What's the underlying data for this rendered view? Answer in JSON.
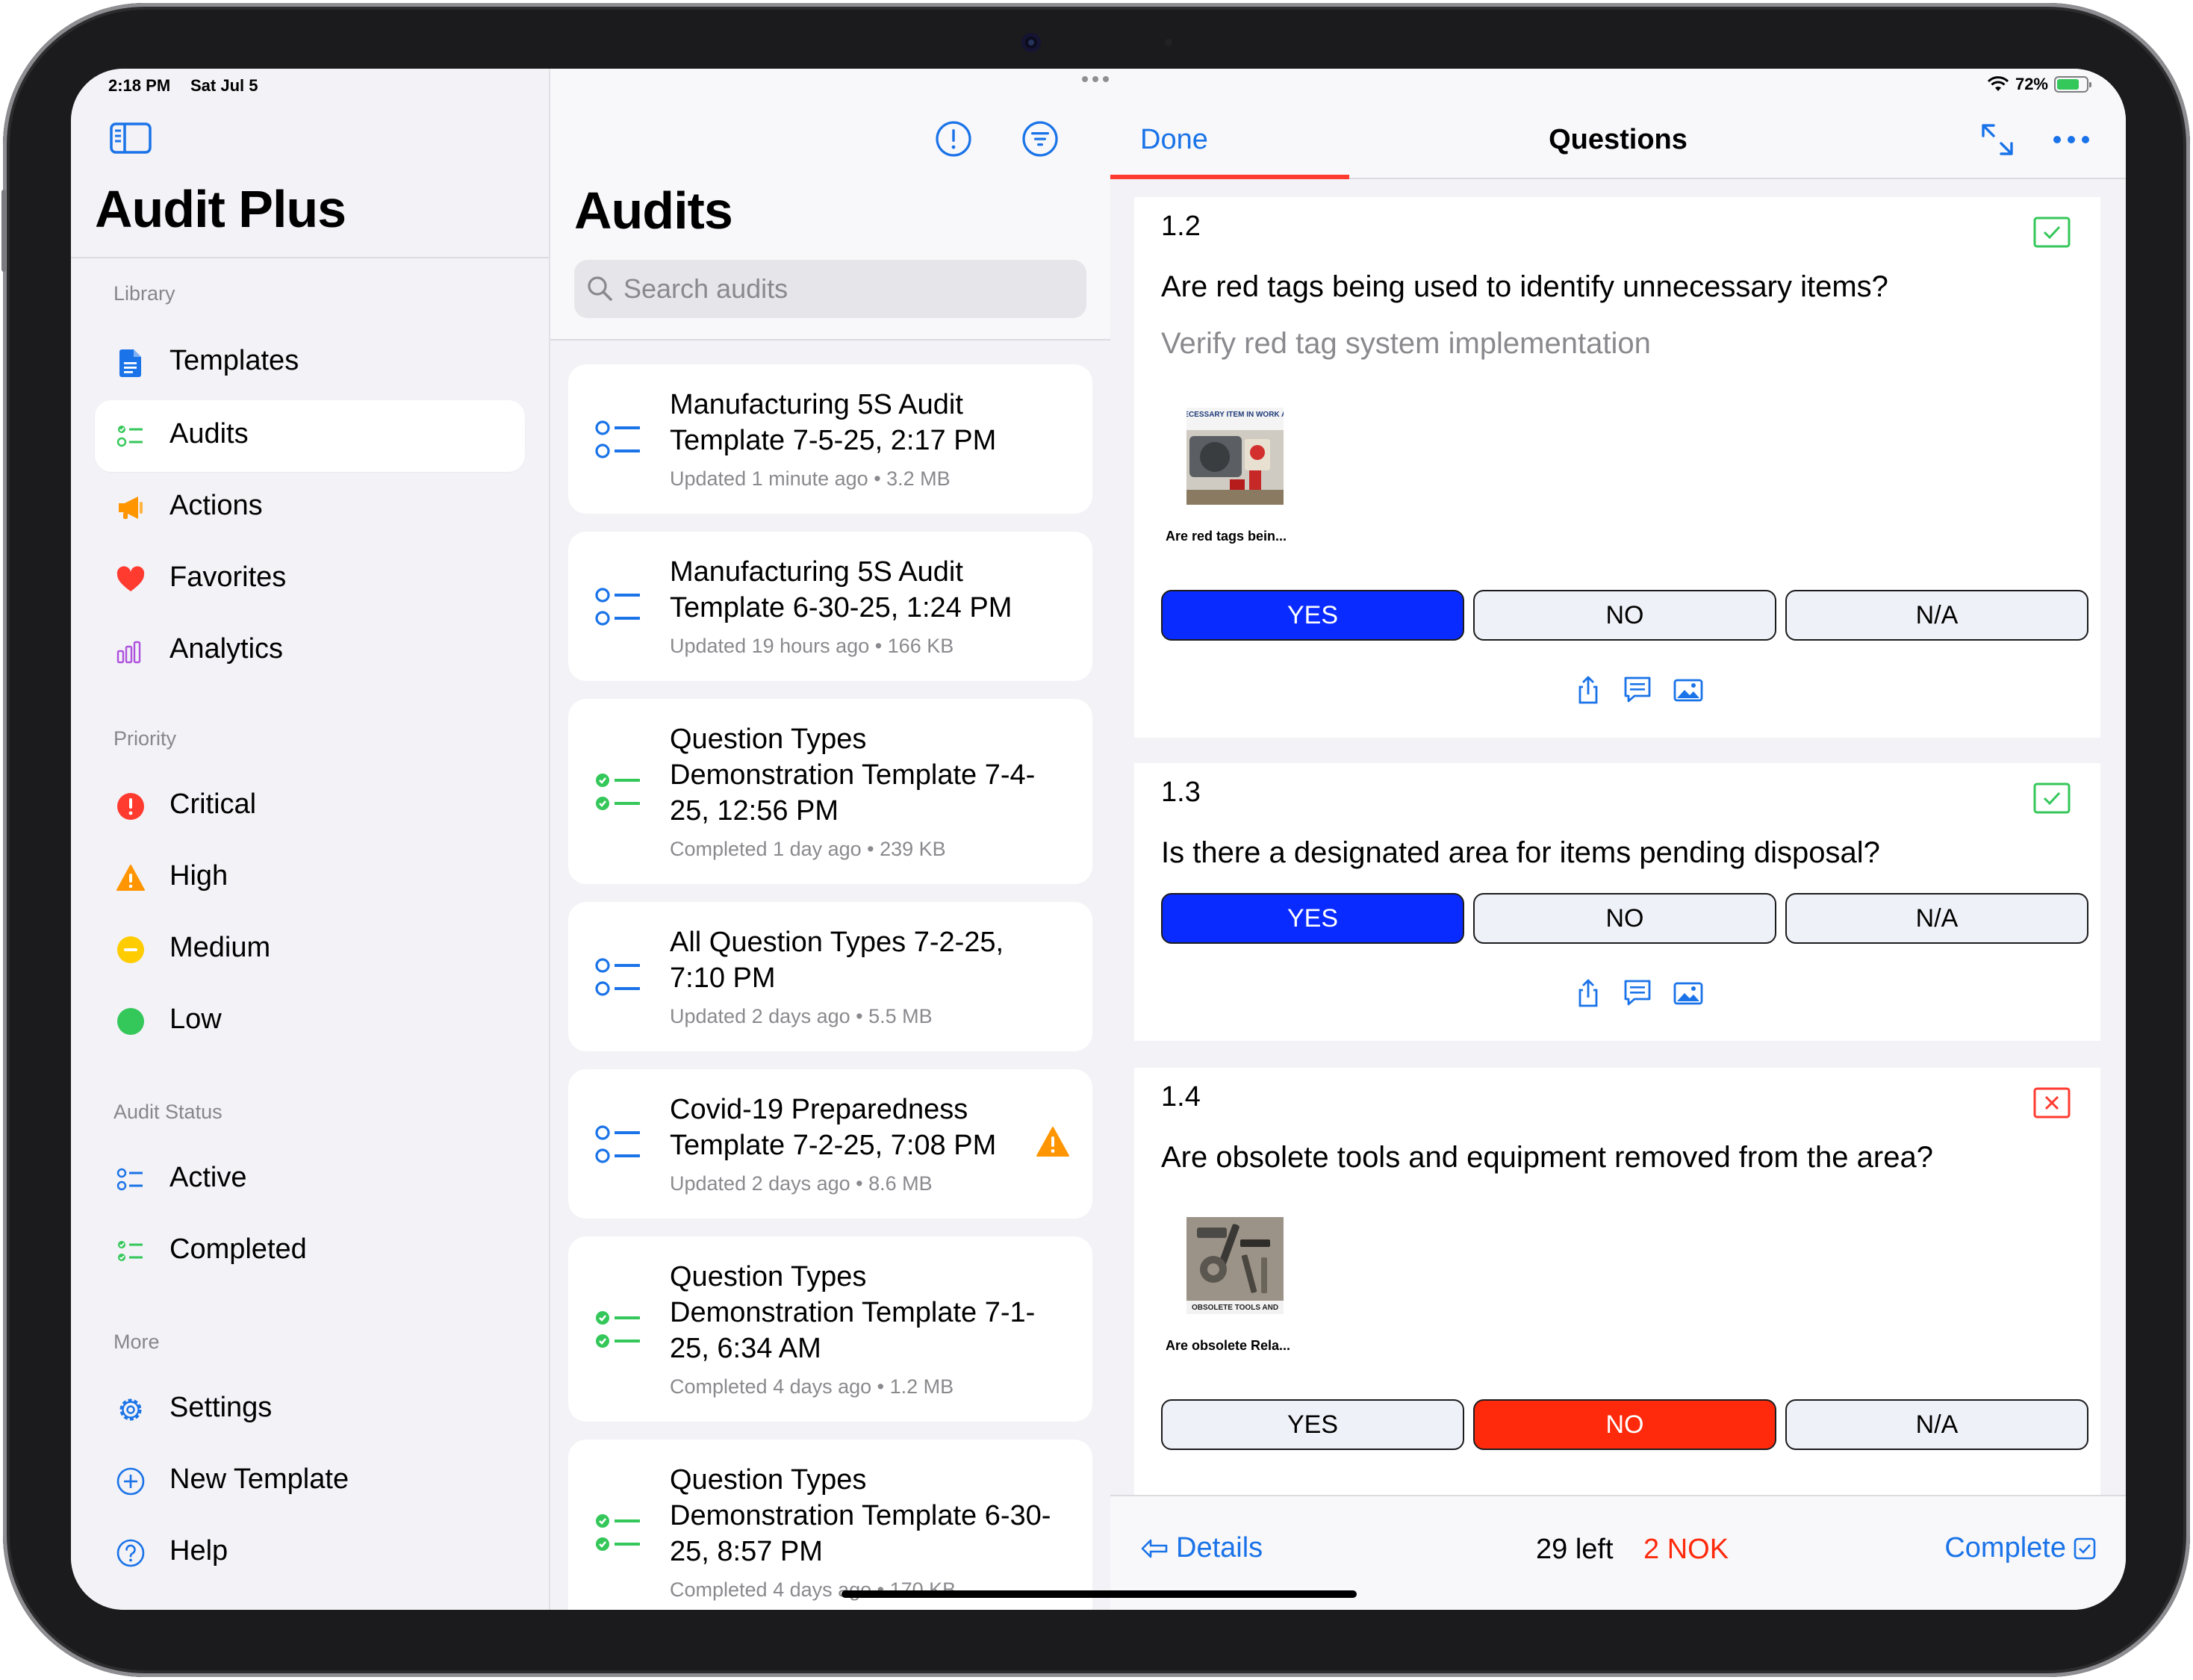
{
  "status_bar": {
    "time": "2:18 PM",
    "date": "Sat Jul 5",
    "battery": "72%"
  },
  "sidebar": {
    "title": "Audit Plus",
    "sections": {
      "library": "Library",
      "priority": "Priority",
      "status": "Audit Status",
      "more": "More"
    },
    "library_items": [
      {
        "label": "Templates",
        "icon": "document-icon"
      },
      {
        "label": "Audits",
        "icon": "checklist-icon",
        "selected": true
      },
      {
        "label": "Actions",
        "icon": "megaphone-icon"
      },
      {
        "label": "Favorites",
        "icon": "heart-icon"
      },
      {
        "label": "Analytics",
        "icon": "chart-icon"
      }
    ],
    "priority_items": [
      {
        "label": "Critical",
        "color": "#ff3b30"
      },
      {
        "label": "High",
        "color": "#ff9500"
      },
      {
        "label": "Medium",
        "color": "#ffcc00"
      },
      {
        "label": "Low",
        "color": "#34c759"
      }
    ],
    "status_items": [
      {
        "label": "Active",
        "icon": "checklist-icon"
      },
      {
        "label": "Completed",
        "icon": "checklist-done-icon"
      }
    ],
    "more_items": [
      {
        "label": "Settings",
        "icon": "gear-icon"
      },
      {
        "label": "New Template",
        "icon": "plus-circle-icon"
      },
      {
        "label": "Help",
        "icon": "question-circle-icon"
      }
    ]
  },
  "audits": {
    "title": "Audits",
    "search_placeholder": "Search audits",
    "items": [
      {
        "title": "Manufacturing 5S Audit Template 7-5-25, 2:17 PM",
        "subtitle": "Updated 1 minute ago • 3.2 MB",
        "status": "active"
      },
      {
        "title": "Manufacturing 5S Audit Template 6-30-25, 1:24 PM",
        "subtitle": "Updated 19 hours ago • 166 KB",
        "status": "active"
      },
      {
        "title": "Question Types Demonstration Template 7-4-25, 12:56 PM",
        "subtitle": "Completed 1 day ago • 239 KB",
        "status": "completed"
      },
      {
        "title": "All Question Types 7-2-25, 7:10 PM",
        "subtitle": "Updated 2 days ago • 5.5 MB",
        "status": "active"
      },
      {
        "title": "Covid-19 Preparedness Template 7-2-25, 7:08 PM",
        "subtitle": "Updated 2 days ago • 8.6 MB",
        "status": "active",
        "warning": true
      },
      {
        "title": "Question Types Demonstration Template 7-1-25, 6:34 AM",
        "subtitle": "Completed 4 days ago • 1.2 MB",
        "status": "completed"
      },
      {
        "title": "Question Types Demonstration Template 6-30-25, 8:57 PM",
        "subtitle": "Completed 4 days ago • 170 KB",
        "status": "completed"
      }
    ]
  },
  "detail": {
    "done_label": "Done",
    "title": "Questions",
    "questions": [
      {
        "number": "1.2",
        "text": "Are red tags being used to identify unnecessary items?",
        "note": "Verify red tag system implementation",
        "image_caption": "Are red tags bein...",
        "image_label": "UNNECESSARY ITEM IN WORK AREA",
        "answers": [
          "YES",
          "NO",
          "N/A"
        ],
        "selected": "YES",
        "state": "pass"
      },
      {
        "number": "1.3",
        "text": "Is there a designated area for items pending disposal?",
        "answers": [
          "YES",
          "NO",
          "N/A"
        ],
        "selected": "YES",
        "state": "pass"
      },
      {
        "number": "1.4",
        "text": "Are obsolete tools and equipment removed from the area?",
        "image_caption": "Are obsolete Rela...",
        "image_label": "OBSOLETE TOOLS AND",
        "answers": [
          "YES",
          "NO",
          "N/A"
        ],
        "selected": "NO",
        "state": "fail"
      }
    ],
    "footer": {
      "details_label": "Details",
      "left_count": "29 left",
      "nok_count": "2 NOK",
      "complete_label": "Complete"
    },
    "colors": {
      "accent": "#1a73e8",
      "yes": "#0a2bff",
      "no": "#ff2a0c",
      "pass": "#34c759",
      "fail": "#ff3b30"
    }
  }
}
